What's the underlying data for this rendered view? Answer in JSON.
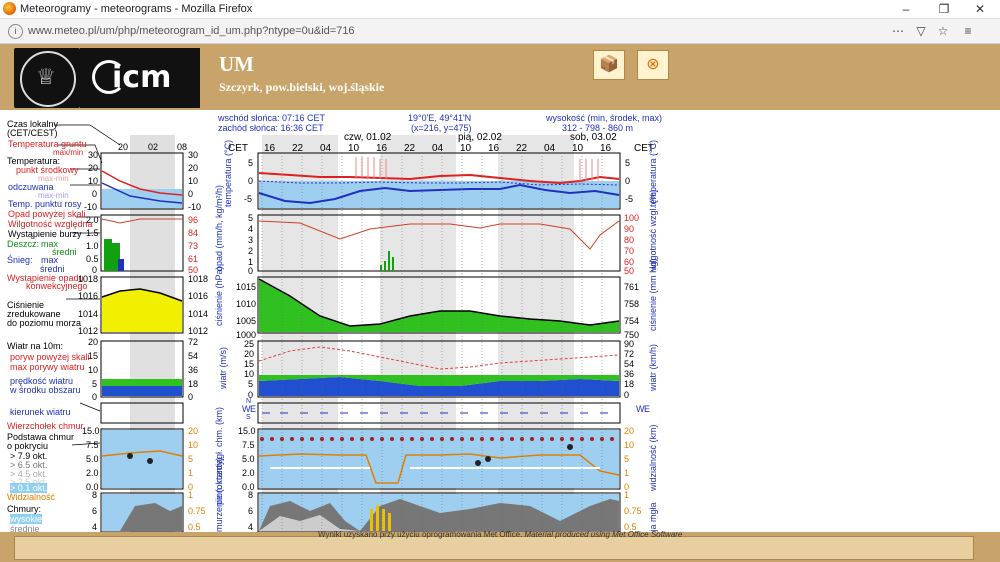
{
  "window": {
    "title": "Meteorogramy - meteorograms - Mozilla Firefox",
    "url_host": "www.meteo.pl",
    "url_path": "/um/php/meteorogram_id_um.php?ntype=0u&id=716"
  },
  "header": {
    "model": "UM",
    "location": "Szczyrk, pow.bielski, woj.śląskie",
    "logo_uw": "UNIWERSYTET WARSZAWSKI",
    "logo_icm": "icm"
  },
  "info": {
    "sunrise": "wschód słońca: 07:16 CET",
    "sunset": "zachód słońca: 16:36 CET",
    "coords": "19°0'E, 49°41'N",
    "grid": "(x=216,  y=475)",
    "alt_label": "wysokość (min, środek, max)",
    "alt_values": "312 - 798 - 860 m"
  },
  "time": {
    "cet": "CET",
    "days": [
      "czw, 01.02",
      "pią, 02.02",
      "sob, 03.02"
    ],
    "hours": [
      "16",
      "22",
      "04",
      "10",
      "16",
      "22",
      "04",
      "10",
      "16",
      "22",
      "04",
      "10",
      "16"
    ],
    "legend_hours": [
      "20",
      "02",
      "08"
    ]
  },
  "legend": {
    "local_time": "Czas lokalny",
    "cet_cest": "(CET/CEST)",
    "soil_temp": "Temperatura gruntu",
    "maxmin": "max/min",
    "temp": "Temperatura:",
    "temp_mid": "punkt środkowy",
    "temp_maxmin": "max-min",
    "temp_felt": "odczuwana",
    "temp_felt_maxmin": "max-min",
    "dew": "Temp. punktu rosy",
    "precip_over": "Opad powyżej skali",
    "humidity": "Wilgotność względna",
    "storm": "Wystąpienie burzy",
    "rain": "Deszcz:",
    "rain_max": "max",
    "rain_mid": "średni",
    "snow": "Śnieg:",
    "snow_max": "max",
    "snow_mid": "średni",
    "conv": "Wystąpienie opadu",
    "conv2": "konwekcyjnego",
    "pressure1": "Ciśnienie",
    "pressure2": "zredukowane",
    "pressure3": "do poziomu morza",
    "wind10": "Wiatr na 10m:",
    "gust_over": "poryw powyżej skali",
    "gust_max": "max porywy wiatru",
    "wind_speed": "prędkość wiatru",
    "wind_area": "w środku obszaru",
    "wind_dir": "kierunek wiatru",
    "cloud_top": "Wierzchołek chmur",
    "cloud_base1": "Podstawa chmur",
    "cloud_base2": "o pokryciu",
    "okt79": "> 7.9 okt.",
    "okt65": "> 6.5 okt.",
    "okt45": "> 4.5 okt.",
    "okt25": "> 2.5 okt.",
    "okt01": "> 0.1 okt.",
    "visibility": "Widzialność",
    "clouds": "Chmury:",
    "high": "wysokie",
    "mid": "średnie"
  },
  "axes": {
    "temp_left": [
      "30",
      "20",
      "10",
      "0",
      "-10"
    ],
    "temp_main_left": [
      "5",
      "0",
      "-5"
    ],
    "temp_main_right": [
      "5",
      "0",
      "-5"
    ],
    "temp_unit": "temperatura (°C)",
    "temp_unit_r": "temperatura (°C)",
    "precip_left_legend": [
      "2.0",
      "1.5",
      "1.0",
      "0.5",
      "0"
    ],
    "precip_right_legend": [
      "96",
      "84",
      "73",
      "61",
      "50"
    ],
    "precip_main_left": [
      "5",
      "4",
      "3",
      "2",
      "1",
      "0"
    ],
    "precip_main_right": [
      "100",
      "90",
      "80",
      "70",
      "60",
      "50"
    ],
    "precip_unit": "opad (mm/h, kg/m²/h)",
    "hum_unit": "wilgotność wzgl. (%)",
    "press_legend_left": [
      "1018",
      "1016",
      "1014",
      "1012"
    ],
    "press_legend_right": [
      "1018",
      "1016",
      "1014",
      "1012"
    ],
    "press_main_left": [
      "1015",
      "1010",
      "1005",
      "1000"
    ],
    "press_main_right": [
      "761",
      "758",
      "754",
      "750"
    ],
    "press_unit": "ciśnienie (hPa)",
    "press_unit_r": "ciśnienie (mm Hg)",
    "wind_legend_left": [
      "20",
      "15",
      "10",
      "5",
      "0"
    ],
    "wind_legend_right": [
      "72",
      "54",
      "36",
      "18",
      "0"
    ],
    "wind_main_left": [
      "25",
      "20",
      "15",
      "10",
      "5",
      "0"
    ],
    "wind_main_right": [
      "90",
      "72",
      "54",
      "36",
      "18",
      "0"
    ],
    "wind_unit": "wiatr (m/s)",
    "wind_unit_r": "wiatr (km/h)",
    "cloud_legend_left": [
      "15.0",
      "7.5",
      "5.0",
      "2.0",
      "0.0"
    ],
    "cloud_legend_right": [
      "20",
      "10",
      "5",
      "1",
      "0"
    ],
    "cloud_main_left": [
      "15.0",
      "7.5",
      "5.0",
      "2.0",
      "0.0"
    ],
    "cloud_main_right": [
      "20",
      "10",
      "5",
      "1",
      "0"
    ],
    "cloud_unit": "pion. rozciągł. chm. (km)",
    "vis_unit": "widzialność (km)",
    "cl2_legend_left": [
      "8",
      "6",
      "4"
    ],
    "cl2_legend_right": [
      "1",
      "0.75",
      "0.5"
    ],
    "cl2_main_left": [
      "8",
      "6",
      "4"
    ],
    "cl2_main_right": [
      "1",
      "0.75",
      "0.5"
    ],
    "cl2_unit": "zachmurzenie (oktanty)",
    "cl2_unit_r": "frakcja mgła",
    "dir_labels": [
      "N",
      "W",
      "E",
      "S"
    ]
  },
  "credit": "Wyniki uzyskano przy użyciu oprogramowania Met Office. ",
  "credit_en": "Material produced using Met Office Software",
  "colors": {
    "header": "#c9a46a",
    "temp_red": "#e02020",
    "blue": "#2030c0",
    "green": "#10a010",
    "yellow": "#f0f000"
  }
}
